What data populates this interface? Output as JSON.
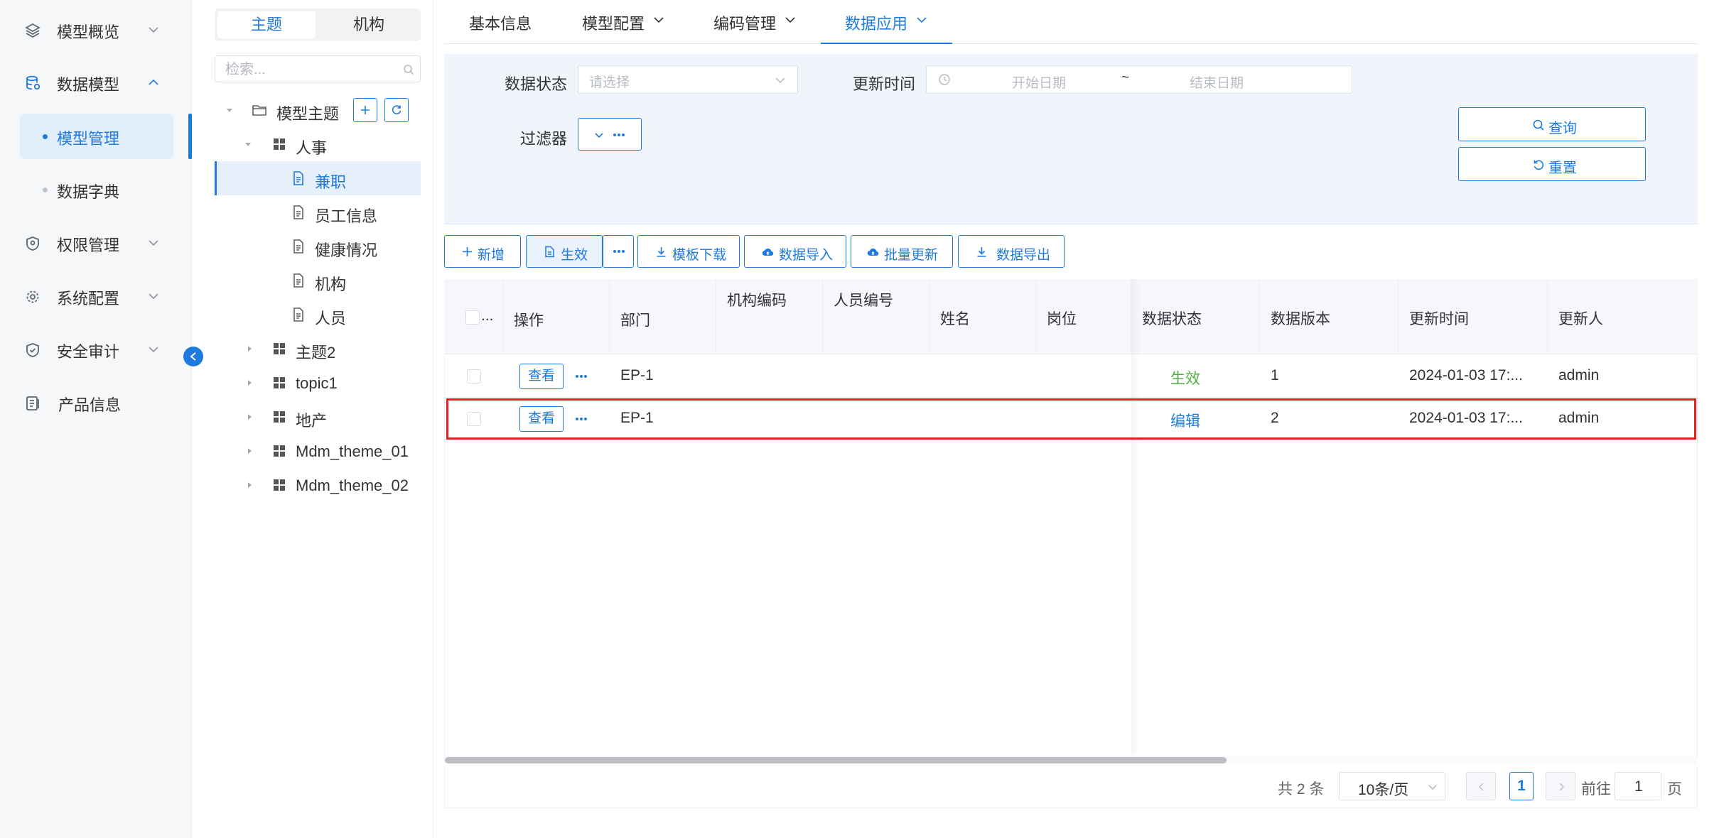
{
  "nav": {
    "items": [
      {
        "label": "模型概览",
        "icon": "layers-icon"
      },
      {
        "label": "数据模型",
        "icon": "database-icon"
      },
      {
        "label": "权限管理",
        "icon": "shield-icon"
      },
      {
        "label": "系统配置",
        "icon": "gear-icon"
      },
      {
        "label": "安全审计",
        "icon": "shield-check-icon"
      },
      {
        "label": "产品信息",
        "icon": "document-icon"
      }
    ],
    "sub_items": [
      {
        "label": "模型管理",
        "active": true
      },
      {
        "label": "数据字典",
        "active": false
      }
    ]
  },
  "tree": {
    "tabs": [
      "主题",
      "机构"
    ],
    "search_placeholder": "检索...",
    "root": "模型主题",
    "group": "人事",
    "leaves": [
      "兼职",
      "员工信息",
      "健康情况",
      "机构",
      "人员"
    ],
    "groups": [
      "主题2",
      "topic1",
      "地产",
      "Mdm_theme_01",
      "Mdm_theme_02"
    ]
  },
  "tabs": [
    "基本信息",
    "模型配置",
    "编码管理",
    "数据应用"
  ],
  "filter": {
    "status_label": "数据状态",
    "status_placeholder": "请选择",
    "time_label": "更新时间",
    "start_placeholder": "开始日期",
    "separator": "~",
    "end_placeholder": "结束日期",
    "filter_label": "过滤器",
    "query_label": "查询",
    "reset_label": "重置"
  },
  "toolbar": {
    "add": "新增",
    "activate": "生效",
    "template_download": "模板下载",
    "import": "数据导入",
    "batch_update": "批量更新",
    "export": "数据导出"
  },
  "table": {
    "select_all": "...",
    "columns": [
      "操作",
      "部门",
      "机构编码",
      "人员编号",
      "姓名",
      "岗位",
      "数据状态",
      "数据版本",
      "更新时间",
      "更新人"
    ],
    "view_label": "查看",
    "rows": [
      {
        "dept": "EP-1",
        "org_code": "",
        "emp_no": "",
        "name": "",
        "post": "",
        "status": "生效",
        "status_color": "#52b043",
        "version": "1",
        "updated": "2024-01-03 17:...",
        "updater": "admin"
      },
      {
        "dept": "EP-1",
        "org_code": "",
        "emp_no": "",
        "name": "",
        "post": "",
        "status": "编辑",
        "status_color": "#1f7ae0",
        "version": "2",
        "updated": "2024-01-03 17:...",
        "updater": "admin"
      }
    ]
  },
  "pager": {
    "total": "共 2 条",
    "page_size": "10条/页",
    "current": "1",
    "goto_label": "前往",
    "goto_value": "1",
    "page_suffix": "页"
  },
  "colors": {
    "primary": "#1f7ae0",
    "highlight": "#e02424",
    "active_status": "#52b043"
  }
}
